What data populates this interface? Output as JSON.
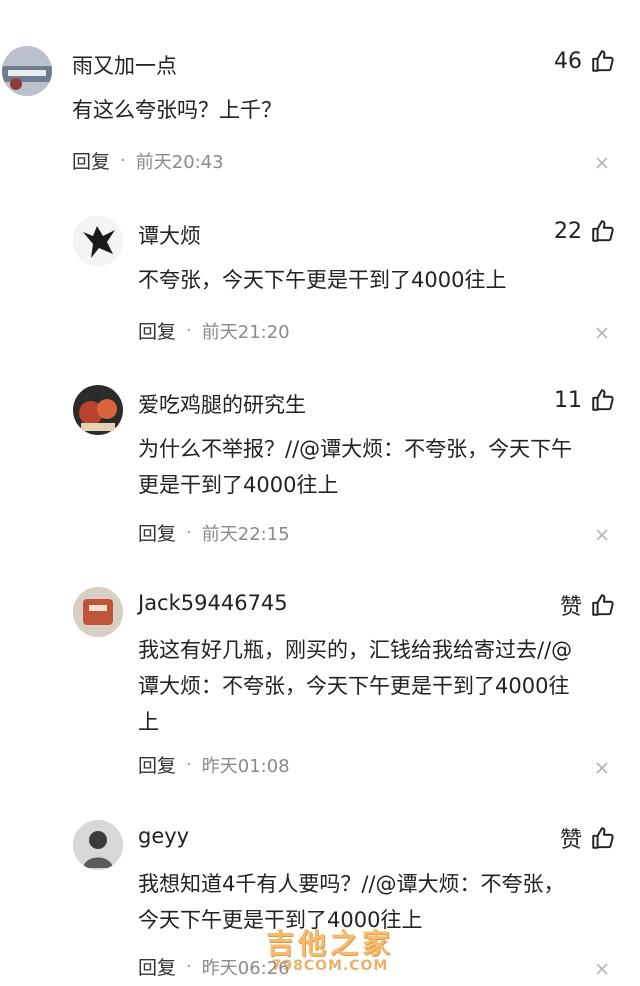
{
  "reply_label": "回复",
  "comments": [
    {
      "name": "雨又加一点",
      "likes": "46",
      "text": "有这么夸张吗？上千？",
      "time": "前天20:43",
      "avatar_color": "#8c98a8"
    },
    {
      "name": "谭大烦",
      "likes": "22",
      "text": "不夸张，今天下午更是干到了4000往上",
      "time": "前天21:20",
      "avatar_color": "#f2f2f2"
    },
    {
      "name": "爱吃鸡腿的研究生",
      "likes": "11",
      "text": "为什么不举报？//@谭大烦：不夸张，今天下午\n更是干到了4000往上",
      "time": "前天22:15",
      "avatar_color": "#a23a2e"
    },
    {
      "name": "Jack59446745",
      "likes": "赞",
      "text": "我这有好几瓶，刚买的，汇钱给我给寄过去//@\n谭大烦：不夸张，今天下午更是干到了4000往\n上",
      "time": "昨天01:08",
      "avatar_color": "#c0533a"
    },
    {
      "name": "geyy",
      "likes": "赞",
      "text": "我想知道4千有人要吗？//@谭大烦：不夸张，\n今天下午更是干到了4000往上",
      "time": "昨天06:26",
      "avatar_color": "#7a7a7a"
    }
  ],
  "watermark": {
    "title": "吉他之家",
    "site": "798COM.COM"
  }
}
